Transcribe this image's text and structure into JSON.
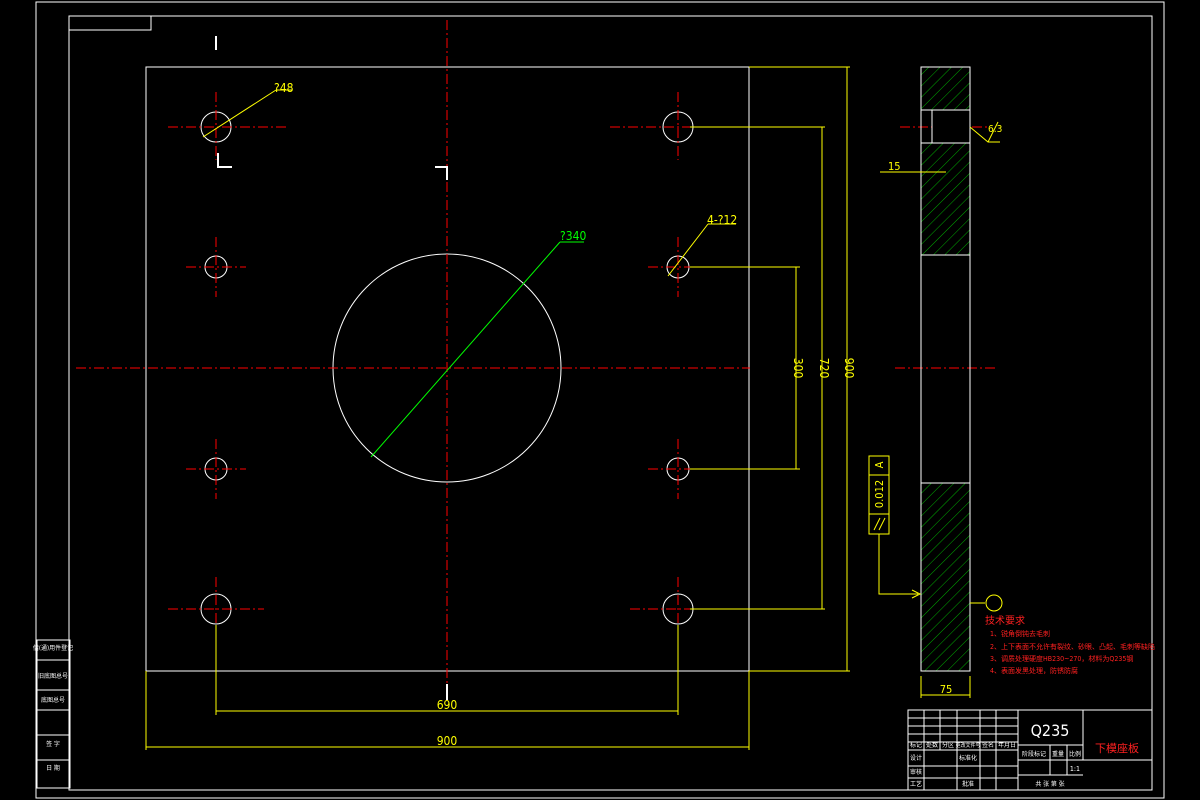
{
  "colors": {
    "background": "#000000",
    "outline": "#ffffff",
    "centerline": "#ff0000",
    "dimension": "#ffff00",
    "leader": "#00ff00",
    "hatch": "#00aa00",
    "notes": "#ff2020"
  },
  "dimensions": {
    "small_hole_dia": "?48",
    "big_hole_dia": "?340",
    "hole_pattern": "4-?12",
    "dim_300": "300",
    "dim_720": "720",
    "dim_900_v": "900",
    "dim_690": "690",
    "dim_900_h": "900",
    "thickness_top": "15",
    "thickness_total": "75",
    "roughness": "6.3",
    "parallelism_value": "0.012",
    "parallelism_datum": "A"
  },
  "tech_requirements": {
    "title": "技术要求",
    "items": [
      "1、锐角倒钝去毛刺",
      "2、上下表面不允许有裂纹、砂眼、凸起、毛刺等缺陷",
      "3、调质处理硬度HB230~270，材料为Q235钢",
      "4、表面发黑处理，防锈防腐"
    ]
  },
  "title_block": {
    "material": "Q235",
    "part_name": "下模座板",
    "marks": [
      "标记",
      "处数",
      "分区",
      "更改文件号",
      "签名",
      "年月日"
    ],
    "roles_row1": [
      "设计",
      "标准化"
    ],
    "roles_row2": [
      "审核"
    ],
    "roles_row3": [
      "工艺",
      "批准"
    ],
    "stage_labels": [
      "阶段标记",
      "重量",
      "比例"
    ],
    "sheet_label": "共 张 第 张",
    "scale": "1:1"
  },
  "side_table": [
    "借(通)用件登记",
    "旧底图总号",
    "底图总号",
    "签 字",
    "日 期"
  ]
}
